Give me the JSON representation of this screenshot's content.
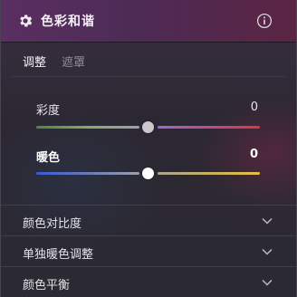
{
  "header": {
    "title": "色彩和谐",
    "icon_left": "gear-icon",
    "icon_right": "info-icon",
    "colors": {
      "bg_start": "#5a2f62",
      "bg_end": "#5b2442"
    }
  },
  "tabs": [
    {
      "label": "调整",
      "active": true
    },
    {
      "label": "遮罩",
      "active": false
    }
  ],
  "sliders": [
    {
      "label": "彩度",
      "value": "0",
      "position_fraction": 0.5,
      "thumb_color": "#c9c9cc",
      "track_left_colors": [
        "#4a8a3a",
        "#8aa86a",
        "#9aa2a8"
      ],
      "track_right_colors": [
        "#9a6ad0",
        "#c04a8a",
        "#d83a3a"
      ]
    },
    {
      "label": "暖色",
      "value": "0",
      "position_fraction": 0.5,
      "thumb_color": "#ffffff",
      "track_left_colors": [
        "#3a5ad8",
        "#6a7ab8",
        "#9aa0a8"
      ],
      "track_right_colors": [
        "#a8a490",
        "#c8b060",
        "#e8c040"
      ]
    }
  ],
  "sections": [
    {
      "label": "颜色对比度",
      "icon": "chevron-down-icon"
    },
    {
      "label": "单独暖色调整",
      "icon": "chevron-down-icon"
    },
    {
      "label": "颜色平衡",
      "icon": "chevron-down-icon"
    }
  ]
}
